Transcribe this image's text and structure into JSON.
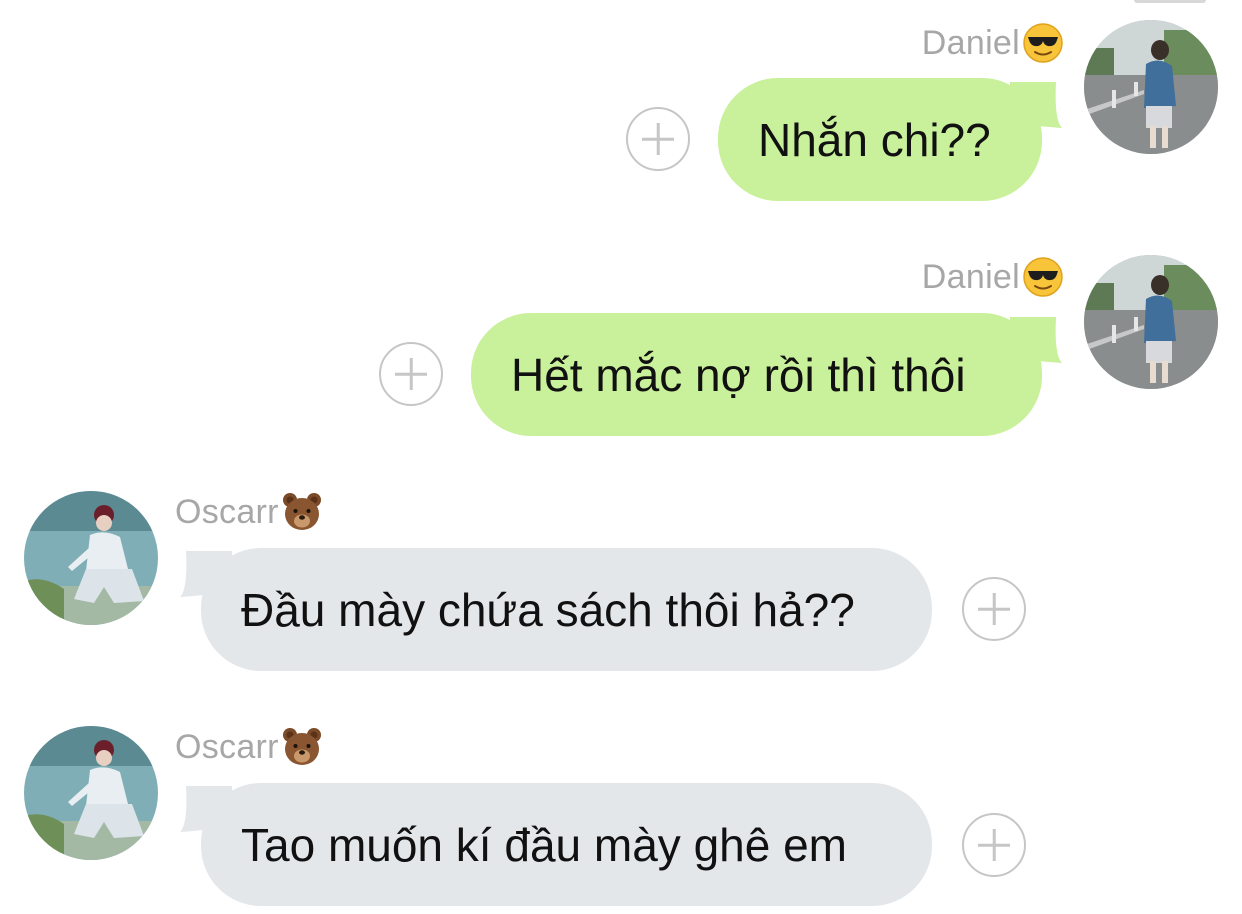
{
  "messages": [
    {
      "direction": "outgoing",
      "sender": "Daniel",
      "sender_emoji": "sunglasses-emoji",
      "text": "Nhắn chi??"
    },
    {
      "direction": "outgoing",
      "sender": "Daniel",
      "sender_emoji": "sunglasses-emoji",
      "text": "Hết mắc nợ rồi thì thôi"
    },
    {
      "direction": "incoming",
      "sender": "Oscarr",
      "sender_emoji": "bear-face-emoji",
      "text": "Đầu mày chứa sách thôi hả??"
    },
    {
      "direction": "incoming",
      "sender": "Oscarr",
      "sender_emoji": "bear-face-emoji",
      "text": "Tao muốn kí đầu mày ghê em"
    }
  ],
  "colors": {
    "outgoing_bubble": "#c9f09a",
    "incoming_bubble": "#e4e7ea",
    "sender_name": "#a7a7a7",
    "add_button": "#c6c6c6"
  },
  "icons": {
    "add_button": "plus-circle-icon"
  }
}
